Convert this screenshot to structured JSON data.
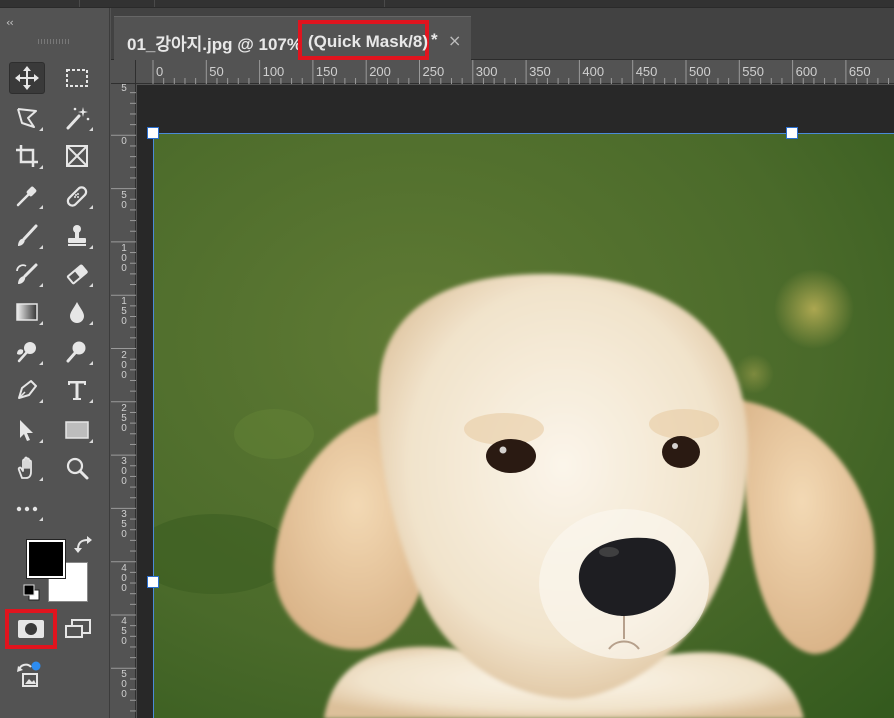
{
  "document_tab": {
    "title": "01_강아지.jpg @ 107%",
    "mode": "(Quick Mask/8)",
    "modified_marker": "*",
    "close_glyph": "×"
  },
  "toolbar": {
    "collapse_glyph": "‹‹",
    "tools": [
      {
        "name": "move-tool",
        "icon": "move-icon",
        "active": true
      },
      {
        "name": "rectangular-marquee-tool",
        "icon": "marquee-icon"
      },
      {
        "name": "polygonal-lasso-tool",
        "icon": "lasso-icon"
      },
      {
        "name": "magic-wand-tool",
        "icon": "magic-wand-icon"
      },
      {
        "name": "crop-tool",
        "icon": "crop-icon"
      },
      {
        "name": "frame-tool",
        "icon": "frame-icon"
      },
      {
        "name": "eyedropper-tool",
        "icon": "eyedropper-icon"
      },
      {
        "name": "spot-healing-tool",
        "icon": "bandage-icon"
      },
      {
        "name": "brush-tool",
        "icon": "brush-icon"
      },
      {
        "name": "clone-stamp-tool",
        "icon": "stamp-icon"
      },
      {
        "name": "history-brush-tool",
        "icon": "history-brush-icon"
      },
      {
        "name": "eraser-tool",
        "icon": "eraser-icon"
      },
      {
        "name": "gradient-tool",
        "icon": "gradient-icon"
      },
      {
        "name": "blur-tool",
        "icon": "drop-icon"
      },
      {
        "name": "dodge-tool",
        "icon": "dodge-icon"
      },
      {
        "name": "pen-tool",
        "icon": "pen-icon"
      },
      {
        "name": "type-tool",
        "icon": "type-icon"
      },
      {
        "name": "path-selection-tool",
        "icon": "arrow-icon"
      },
      {
        "name": "rectangle-tool",
        "icon": "rectangle-icon"
      },
      {
        "name": "hand-tool",
        "icon": "hand-icon"
      },
      {
        "name": "zoom-tool",
        "icon": "zoom-icon"
      },
      {
        "name": "more-tools",
        "icon": "ellipsis-icon"
      }
    ],
    "foreground_color": "#000000",
    "background_color": "#ffffff"
  },
  "rulers": {
    "horizontal": [
      "0",
      "50",
      "100",
      "150",
      "200",
      "250",
      "300",
      "350",
      "400",
      "450",
      "500",
      "550",
      "600",
      "650"
    ],
    "vertical": [
      "5",
      "0",
      "5\n0",
      "1\n0\n0",
      "1\n5\n0",
      "2\n0\n0",
      "2\n5\n0",
      "3\n0\n0",
      "3\n5\n0",
      "4\n0\n0",
      "4\n5\n0",
      "5\n0\n0"
    ]
  },
  "colors": {
    "highlight": "#e0141e",
    "selection": "#2a6fd0"
  }
}
